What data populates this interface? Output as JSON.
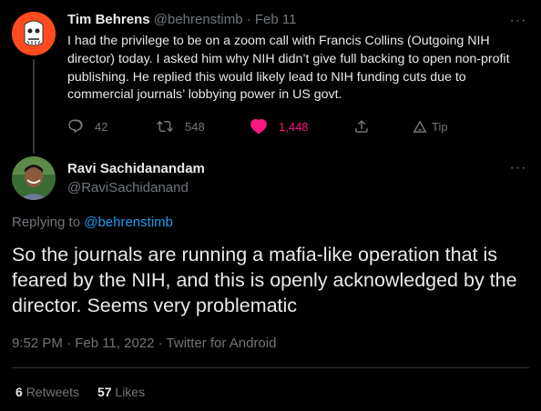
{
  "parent_tweet": {
    "author_name": "Tim Behrens",
    "author_handle": "@behrenstimb",
    "separator": "·",
    "date": "Feb 11",
    "text": "I had the privilege to be on a zoom call with Francis Collins (Outgoing NIH director) today.  I asked him why NIH didn’t give full backing to open non-profit publishing. He replied this would likely lead to NIH funding cuts due to commercial journals’ lobbying power in US govt.",
    "more_label": "···",
    "actions": {
      "reply_count": "42",
      "retweet_count": "548",
      "like_count": "1,448",
      "tip_label": "Tip"
    }
  },
  "reply_tweet": {
    "author_name": "Ravi Sachidanandam",
    "author_handle": "@RaviSachidanand",
    "more_label": "···",
    "replying_to_label": "Replying to",
    "replying_to_handle": "@behrenstimb",
    "text": "So the journals are running a mafia-like operation that is feared by the NIH, and this is openly acknowledged by the director. Seems very problematic",
    "meta": "9:52 PM · Feb 11, 2022 · Twitter for Android",
    "stats": {
      "retweets_count": "6",
      "retweets_label": "Retweets",
      "likes_count": "57",
      "likes_label": "Likes"
    }
  },
  "colors": {
    "background": "#000000",
    "text": "#e7e9ea",
    "muted": "#71767b",
    "link": "#1d9bf0",
    "like": "#f91880",
    "divider": "#2f3336",
    "parent_avatar": "#ff4b1f"
  }
}
